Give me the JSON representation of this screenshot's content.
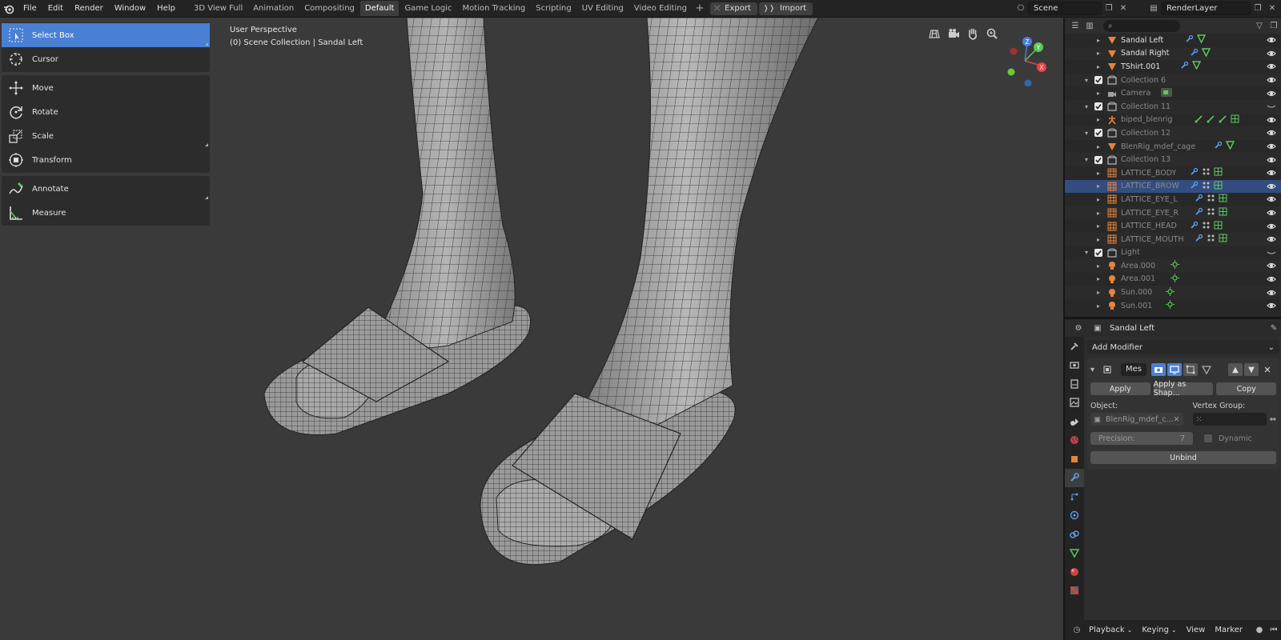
{
  "menu": [
    "File",
    "Edit",
    "Render",
    "Window",
    "Help"
  ],
  "workspaces": [
    "3D View Full",
    "Animation",
    "Compositing",
    "Default",
    "Game Logic",
    "Motion Tracking",
    "Scripting",
    "UV Editing",
    "Video Editing"
  ],
  "active_workspace": "Default",
  "export_label": "Export",
  "import_label": "Import",
  "scene_name": "Scene",
  "view_layer": "RenderLayer",
  "tools": {
    "select_box": "Select Box",
    "cursor": "Cursor",
    "move": "Move",
    "rotate": "Rotate",
    "scale": "Scale",
    "transform": "Transform",
    "annotate": "Annotate",
    "measure": "Measure"
  },
  "viewport": {
    "perspective": "User Perspective",
    "collection_info": "(0) Scene Collection | Sandal Left"
  },
  "gizmo": {
    "z": "Z",
    "y": "Y",
    "x": "X"
  },
  "outliner": {
    "rows": [
      {
        "label": "Sandal Left",
        "type": "mesh"
      },
      {
        "label": "Sandal Right",
        "type": "mesh"
      },
      {
        "label": "TShirt.001",
        "type": "mesh"
      },
      {
        "label": "Collection 6",
        "type": "collection"
      },
      {
        "label": "Camera",
        "type": "camera"
      },
      {
        "label": "Collection 11",
        "type": "collection"
      },
      {
        "label": "biped_blenrig",
        "type": "armature"
      },
      {
        "label": "Collection 12",
        "type": "collection"
      },
      {
        "label": "BlenRig_mdef_cage",
        "type": "mesh"
      },
      {
        "label": "Collection 13",
        "type": "collection"
      },
      {
        "label": "LATTICE_BODY",
        "type": "lattice"
      },
      {
        "label": "LATTICE_BROW",
        "type": "lattice"
      },
      {
        "label": "LATTICE_EYE_L",
        "type": "lattice"
      },
      {
        "label": "LATTICE_EYE_R",
        "type": "lattice"
      },
      {
        "label": "LATTICE_HEAD",
        "type": "lattice"
      },
      {
        "label": "LATTICE_MOUTH",
        "type": "lattice"
      },
      {
        "label": "Light",
        "type": "collection"
      },
      {
        "label": "Area.000",
        "type": "light"
      },
      {
        "label": "Area.001",
        "type": "light"
      },
      {
        "label": "Sun.000",
        "type": "light"
      },
      {
        "label": "Sun.001",
        "type": "light"
      }
    ]
  },
  "properties": {
    "object_name": "Sandal Left",
    "add_modifier": "Add Modifier",
    "modifier_name": "Mes",
    "apply": "Apply",
    "apply_as_shape": "Apply as Shap...",
    "copy": "Copy",
    "object_label": "Object:",
    "object_value": "BlenRig_mdef_c...",
    "vertex_group_label": "Vertex Group:",
    "precision_label": "Precision:",
    "precision_value": "7",
    "dynamic_label": "Dynamic",
    "unbind": "Unbind"
  },
  "timeline": {
    "playback": "Playback",
    "keying": "Keying",
    "view": "View",
    "marker": "Marker"
  },
  "colors": {
    "accent": "#4a7fd3",
    "selected_row": "#334d80",
    "mesh_icon": "#e8843a",
    "data_icon": "#5cc85c",
    "modifier_icon": "#5b9ee8"
  }
}
